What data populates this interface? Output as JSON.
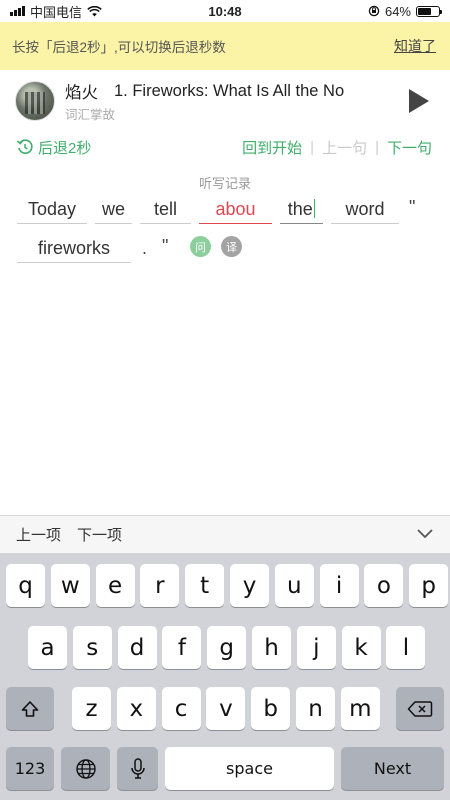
{
  "status_bar": {
    "carrier": "中国电信",
    "time": "10:48",
    "battery": "64%",
    "battery_level": 0.64
  },
  "tip": {
    "text": "长按「后退2秒」,可以切换后退秒数",
    "dismiss": "知道了"
  },
  "header": {
    "channel": "焰火",
    "title": "1. Fireworks: What Is All the No",
    "subtitle": "词汇掌故"
  },
  "controls": {
    "rewind": "后退2秒",
    "restart": "回到开始",
    "prev": "上一句",
    "next": "下一句"
  },
  "history_label": "听写记录",
  "dictation": {
    "words": [
      "Today",
      "we",
      "tell",
      "abou",
      "the",
      "word",
      "fireworks"
    ],
    "punct": [
      "\"",
      ".",
      "\""
    ],
    "ask_label": "问",
    "translate_label": "译"
  },
  "accessory": {
    "prev": "上一项",
    "next": "下一项"
  },
  "keyboard": {
    "row1": [
      "q",
      "w",
      "e",
      "r",
      "t",
      "y",
      "u",
      "i",
      "o",
      "p"
    ],
    "row2": [
      "a",
      "s",
      "d",
      "f",
      "g",
      "h",
      "j",
      "k",
      "l"
    ],
    "row3": [
      "z",
      "x",
      "c",
      "v",
      "b",
      "n",
      "m"
    ],
    "numbers": "123",
    "space": "space",
    "next": "Next"
  },
  "colors": {
    "accent": "#3fae6b",
    "error": "#e04851",
    "tip_bg": "#fbf3a6"
  }
}
